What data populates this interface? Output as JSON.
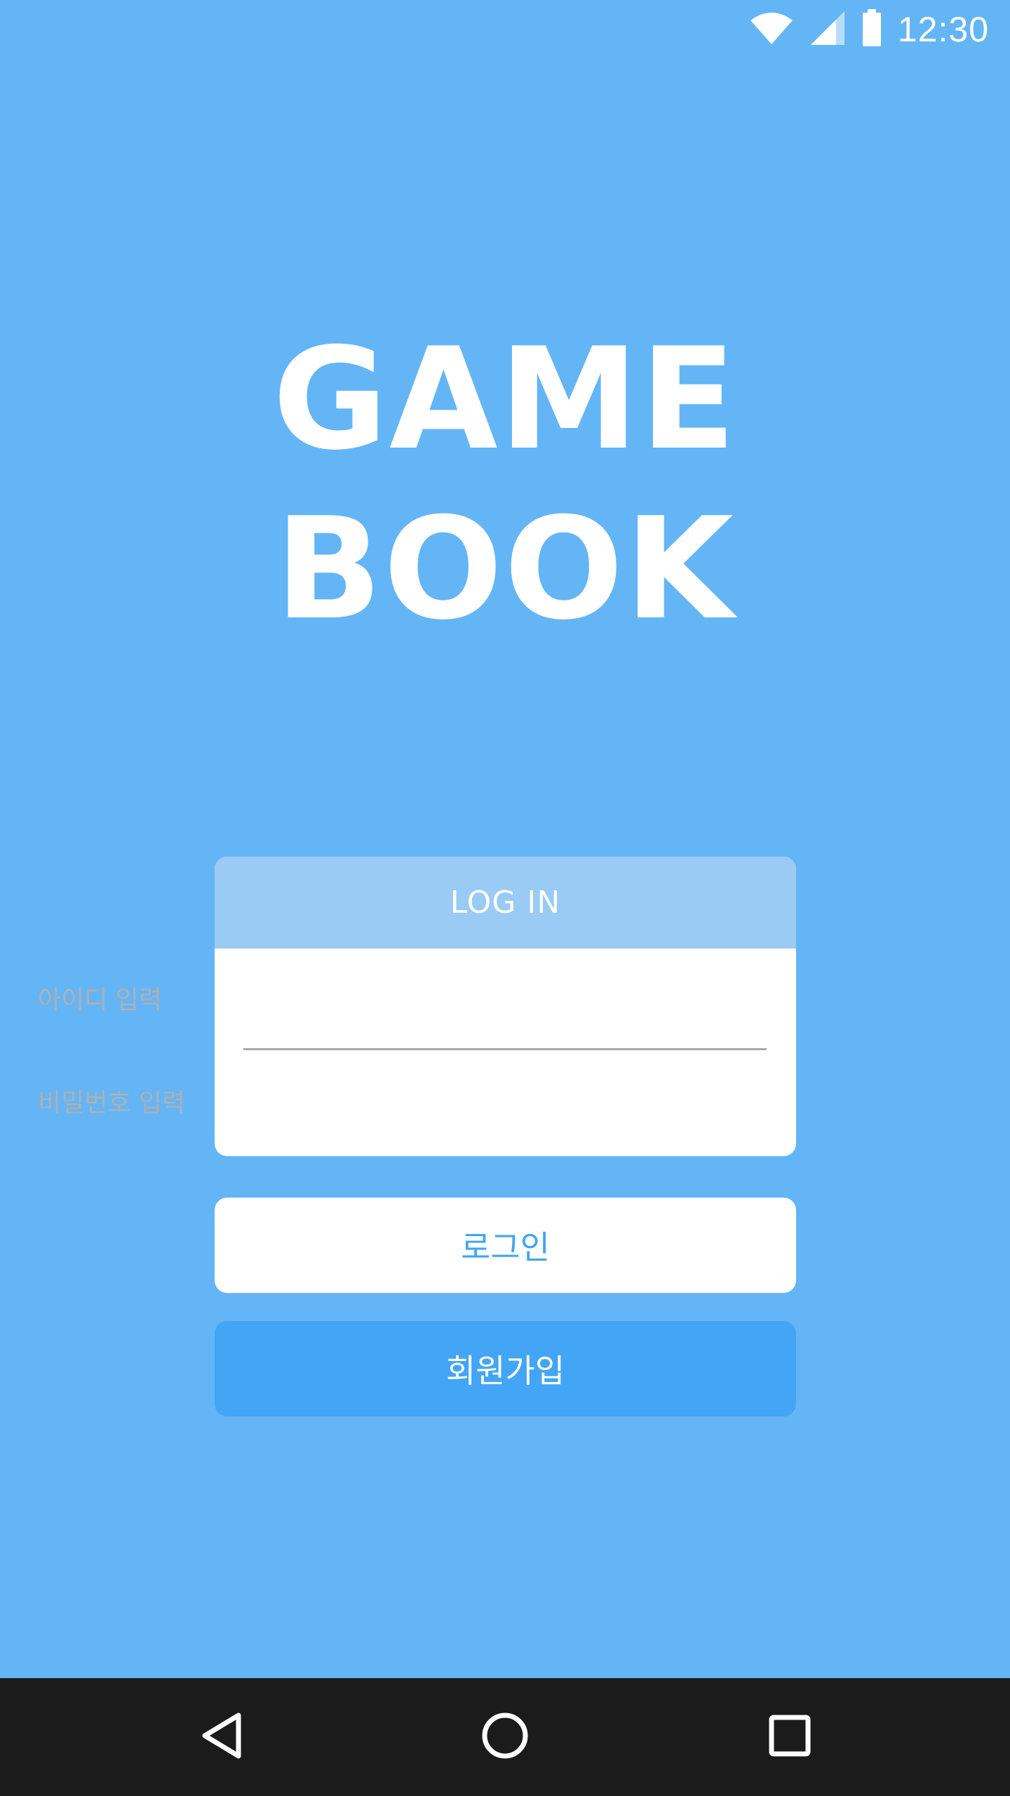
{
  "status_bar": {
    "time": "12:30",
    "icons": [
      "wifi-icon",
      "cellular-signal-icon",
      "battery-icon"
    ]
  },
  "logo": {
    "line1": "GAME",
    "line2": "BOOK"
  },
  "login_card": {
    "header": "LOG IN",
    "id_placeholder": "아이디 입력",
    "password_placeholder": "비밀번호 입력"
  },
  "buttons": {
    "login_label": "로그인",
    "signup_label": "회원가입"
  },
  "nav_bar": {
    "icons": [
      "back-icon",
      "home-icon",
      "recents-icon"
    ]
  },
  "colors": {
    "background": "#64B5F6",
    "card_header": "#99CBF4",
    "accent": "#42A5F5",
    "nav_bar": "#1b1b1b"
  }
}
